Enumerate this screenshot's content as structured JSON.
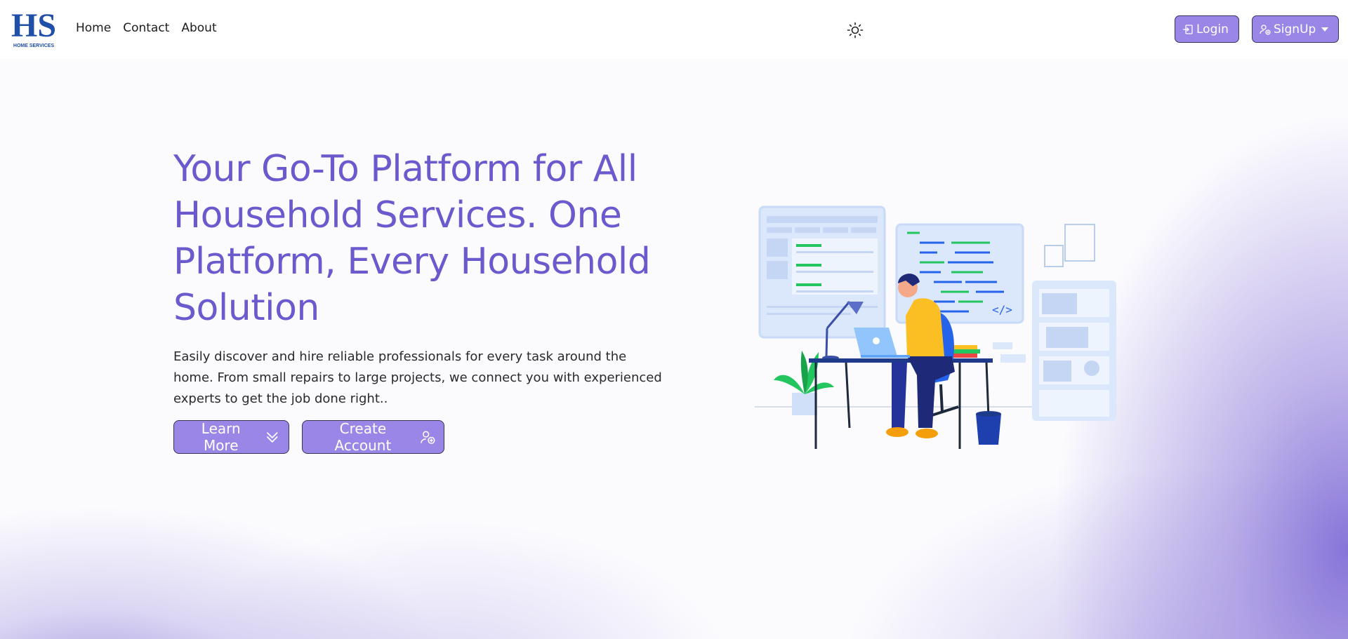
{
  "brand": {
    "logo_letters": "HS",
    "logo_caption": "HOME SERVICES",
    "colors": {
      "logo": "#1f4fa8",
      "accent": "#6a5acd",
      "button": "#9a86e6"
    }
  },
  "nav": {
    "links": [
      "Home",
      "Contact",
      "About"
    ],
    "theme_icon": "sun-icon",
    "login_label": "Login",
    "signup_label": "SignUp"
  },
  "hero": {
    "title": "Your Go-To Platform for All Household Services. One Platform, Every Household Solution",
    "description": "Easily discover and hire reliable professionals for every task around the home. From small repairs to large projects, we connect you with experienced experts to get the job done right..",
    "learn_more_label": "Learn More",
    "create_account_label": "Create Account",
    "illustration_code_tag": "</>"
  }
}
